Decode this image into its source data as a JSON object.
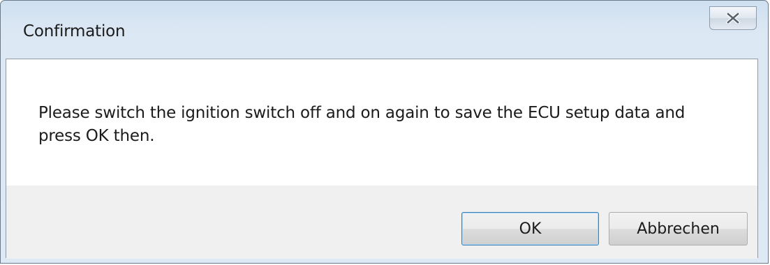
{
  "window": {
    "title": "Confirmation",
    "close_icon": "close-icon"
  },
  "message": {
    "line1": "Please switch the ignition switch off and on again to save the ECU setup data and",
    "line2": "press OK then."
  },
  "buttons": {
    "ok_label": "OK",
    "cancel_label": "Abbrechen"
  },
  "colors": {
    "titlebar": "#dce8f4",
    "content_background": "#ffffff",
    "button_area": "#f0f0f0",
    "default_button_border": "#3c7fb1"
  }
}
